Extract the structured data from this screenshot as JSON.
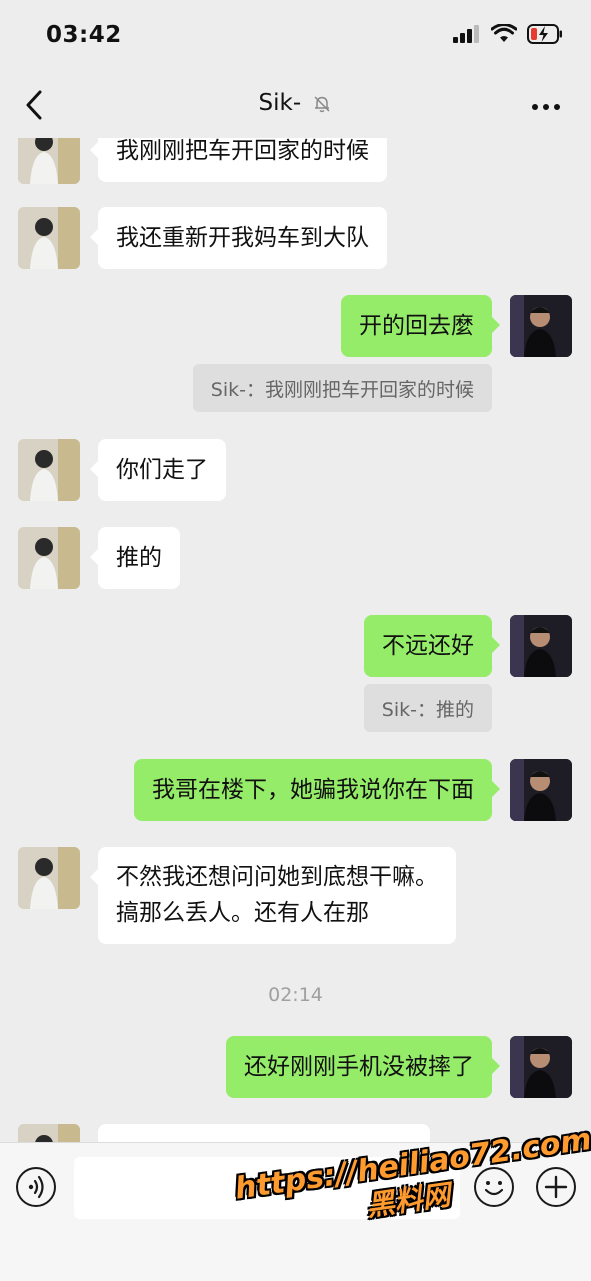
{
  "status_bar": {
    "time": "03:42"
  },
  "header": {
    "title": "Sik-"
  },
  "messages": {
    "m1": "我刚刚把车开回家的时候",
    "m2": "我还重新开我妈车到大队",
    "m3": "开的回去麼",
    "q1": "Sik-：我刚刚把车开回家的时候",
    "m4": "你们走了",
    "m5": "推的",
    "m6": "不远还好",
    "q2": "Sik-：推的",
    "m7": "我哥在楼下，她骗我说你在下面",
    "m8_line1": "不然我还想问问她到底想干嘛。",
    "m8_line2": "搞那么丢人。还有人在那",
    "timestamp": "02:14",
    "m9": "还好刚刚手机没被摔了"
  },
  "input": {
    "placeholder": ""
  },
  "watermark": {
    "line1": "https://heiliao72.com",
    "line2": "黑料网"
  },
  "colors": {
    "self_bubble": "#95ec69",
    "other_bubble": "#ffffff",
    "background": "#ededed",
    "watermark": "#ff9a2e"
  }
}
